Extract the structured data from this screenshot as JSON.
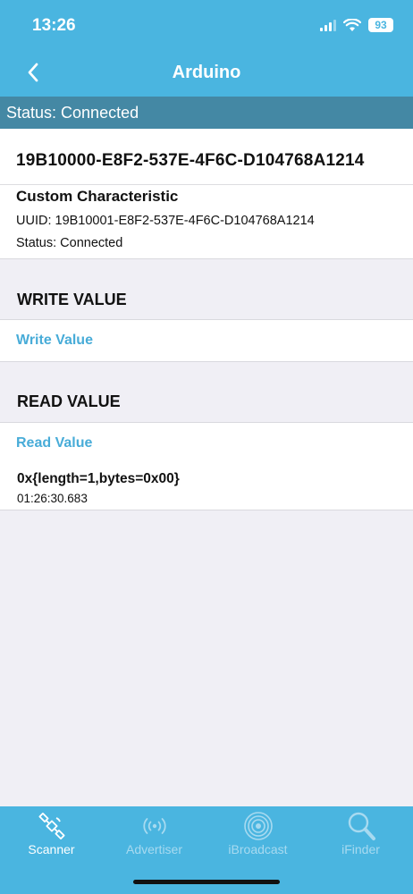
{
  "system": {
    "time": "13:26",
    "battery": "93"
  },
  "nav": {
    "title": "Arduino"
  },
  "connection": {
    "status": "Status: Connected"
  },
  "service": {
    "uuid": "19B10000-E8F2-537E-4F6C-D104768A1214",
    "characteristic": {
      "name": "Custom Characteristic",
      "uuid": "UUID: 19B10001-E8F2-537E-4F6C-D104768A1214",
      "status": "Status: Connected"
    }
  },
  "write": {
    "header": "WRITE VALUE",
    "action": "Write Value"
  },
  "read": {
    "header": "READ VALUE",
    "action": "Read Value",
    "value": "0x{length=1,bytes=0x00}",
    "timestamp": "01:26:30.683"
  },
  "tabs": [
    {
      "label": "Scanner",
      "icon": "satellite-icon",
      "active": true
    },
    {
      "label": "Advertiser",
      "icon": "broadcast-icon",
      "active": false
    },
    {
      "label": "iBroadcast",
      "icon": "beacon-icon",
      "active": false
    },
    {
      "label": "iFinder",
      "icon": "magnifier-icon",
      "active": false
    }
  ],
  "colors": {
    "accent": "#4ab5e0",
    "status_bar": "#4488a4",
    "link": "#48acd8"
  }
}
